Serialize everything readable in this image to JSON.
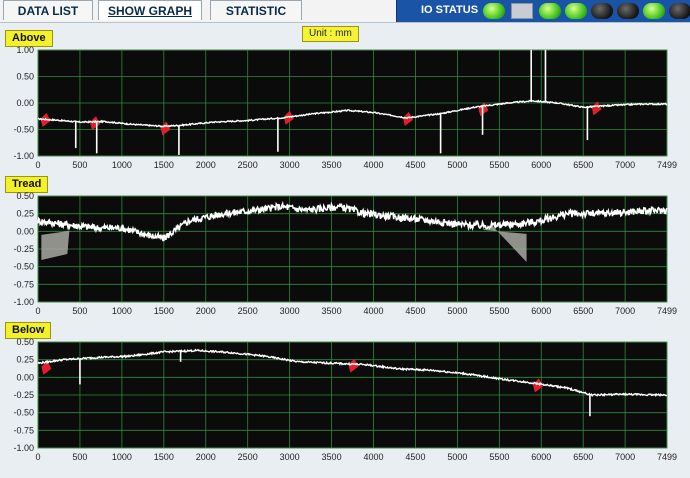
{
  "tabs": [
    {
      "label": "DATA  LIST",
      "active": false
    },
    {
      "label": "SHOW GRAPH",
      "active": true
    },
    {
      "label": "STATISTIC",
      "active": false
    }
  ],
  "io_status": {
    "label": "IO STATUS",
    "lamps": [
      "on",
      "box",
      "on",
      "on",
      "off",
      "off",
      "on",
      "off"
    ]
  },
  "unit_label": "Unit : mm",
  "colors": {
    "plot_bg": "#0b0b0b",
    "grid": "#2e8a3a",
    "trace": "#ffffff",
    "deviation": "#e3202a",
    "panel_label_bg": "#f4f02a"
  },
  "chart_data": [
    {
      "type": "line",
      "title": "Above",
      "ylim": [
        -1.0,
        1.0
      ],
      "yticks": [
        "1.00",
        "0.50",
        "0.00",
        "-0.50",
        "-1.00"
      ],
      "xlim": [
        0,
        7499
      ],
      "xticks": [
        "0",
        "500",
        "1000",
        "1500",
        "2000",
        "2500",
        "3000",
        "3500",
        "4000",
        "4500",
        "5000",
        "5500",
        "6000",
        "6500",
        "7000",
        "7499"
      ],
      "x": [
        0,
        200,
        500,
        800,
        1100,
        1500,
        1700,
        2100,
        2500,
        2900,
        3300,
        3700,
        4000,
        4400,
        4800,
        5200,
        5600,
        5900,
        6200,
        6500,
        6900,
        7200,
        7499
      ],
      "y": [
        -0.3,
        -0.32,
        -0.36,
        -0.35,
        -0.4,
        -0.44,
        -0.42,
        -0.36,
        -0.33,
        -0.28,
        -0.2,
        -0.14,
        -0.18,
        -0.28,
        -0.2,
        -0.08,
        0.0,
        0.04,
        0.0,
        -0.08,
        -0.04,
        -0.02,
        -0.02
      ],
      "spikes": [
        [
          450,
          -0.85
        ],
        [
          700,
          -0.95
        ],
        [
          1680,
          -0.98
        ],
        [
          2860,
          -0.92
        ],
        [
          4800,
          -0.95
        ],
        [
          5300,
          -0.6
        ],
        [
          5880,
          1.0
        ],
        [
          6050,
          1.0
        ],
        [
          6550,
          -0.7
        ]
      ],
      "shaded": [
        [
          30,
          -0.3
        ],
        [
          620,
          -0.36
        ],
        [
          1460,
          -0.46
        ],
        [
          2930,
          -0.26
        ],
        [
          4350,
          -0.28
        ],
        [
          5250,
          -0.1
        ],
        [
          6600,
          -0.08
        ]
      ]
    },
    {
      "type": "line",
      "title": "Tread",
      "ylim": [
        -1.0,
        0.5
      ],
      "yticks": [
        "0.50",
        "0.25",
        "0.00",
        "-0.25",
        "-0.50",
        "-0.75",
        "-1.00"
      ],
      "xlim": [
        0,
        7499
      ],
      "xticks": [
        "0",
        "500",
        "1000",
        "1500",
        "2000",
        "2500",
        "3000",
        "3500",
        "4000",
        "4500",
        "5000",
        "5500",
        "6000",
        "6500",
        "7000",
        "7499"
      ],
      "x": [
        0,
        300,
        700,
        1000,
        1300,
        1500,
        1800,
        2200,
        2600,
        2900,
        3200,
        3600,
        3900,
        4300,
        4700,
        5000,
        5300,
        5700,
        6000,
        6300,
        6700,
        7100,
        7499
      ],
      "y": [
        0.15,
        0.1,
        0.05,
        0.05,
        -0.05,
        -0.1,
        0.15,
        0.25,
        0.3,
        0.35,
        0.3,
        0.35,
        0.25,
        0.2,
        0.15,
        0.1,
        0.08,
        0.1,
        0.15,
        0.25,
        0.25,
        0.28,
        0.3
      ],
      "shaded": [
        [
          40,
          -0.05
        ],
        [
          5300,
          0.02
        ]
      ]
    },
    {
      "type": "line",
      "title": "Below",
      "ylim": [
        -1.0,
        0.5
      ],
      "yticks": [
        "0.50",
        "0.25",
        "0.00",
        "-0.25",
        "-0.50",
        "-0.75",
        "-1.00"
      ],
      "xlim": [
        0,
        7499
      ],
      "xticks": [
        "0",
        "500",
        "1000",
        "1500",
        "2000",
        "2500",
        "3000",
        "3500",
        "4000",
        "4500",
        "5000",
        "5500",
        "6000",
        "6500",
        "7000",
        "7499"
      ],
      "x": [
        0,
        300,
        700,
        1100,
        1500,
        1900,
        2300,
        2700,
        3100,
        3500,
        3900,
        4300,
        4700,
        5100,
        5500,
        5900,
        6300,
        6600,
        7000,
        7499
      ],
      "y": [
        0.2,
        0.25,
        0.28,
        0.3,
        0.36,
        0.38,
        0.35,
        0.3,
        0.22,
        0.2,
        0.18,
        0.12,
        0.1,
        0.05,
        -0.02,
        -0.08,
        -0.15,
        -0.25,
        -0.24,
        -0.25
      ],
      "spikes": [
        [
          500,
          -0.1
        ],
        [
          1700,
          0.22
        ],
        [
          6580,
          -0.55
        ]
      ],
      "shaded": [
        [
          40,
          0.15
        ],
        [
          3700,
          0.18
        ],
        [
          5900,
          -0.1
        ]
      ]
    }
  ]
}
